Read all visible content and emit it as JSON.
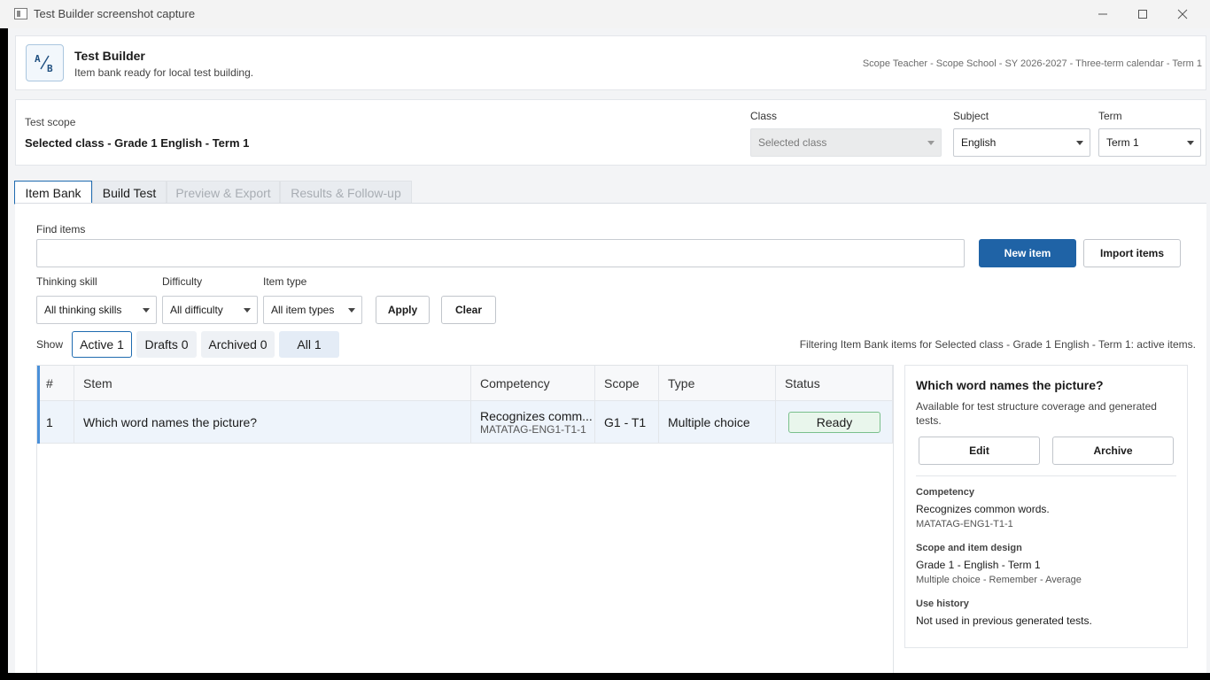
{
  "window": {
    "title": "Test Builder screenshot capture",
    "minimize_icon": "minimize-icon",
    "maximize_icon": "maximize-icon",
    "close_icon": "close-icon"
  },
  "header": {
    "logo_icon": "ab-logo-icon",
    "app_name": "Test Builder",
    "status": "Item bank ready for local test building.",
    "context": "Scope Teacher - Scope School - SY 2026-2027 - Three-term calendar - Term 1"
  },
  "scope": {
    "label": "Test scope",
    "value": "Selected class - Grade 1 English - Term 1",
    "class_label": "Class",
    "class_value": "Selected class",
    "subject_label": "Subject",
    "subject_value": "English",
    "term_label": "Term",
    "term_value": "Term 1"
  },
  "tabs": [
    {
      "label": "Item Bank",
      "state": "active"
    },
    {
      "label": "Build Test",
      "state": "normal"
    },
    {
      "label": "Preview & Export",
      "state": "disabled"
    },
    {
      "label": "Results & Follow-up",
      "state": "disabled"
    }
  ],
  "search": {
    "label": "Find items",
    "value": "",
    "placeholder": ""
  },
  "actions": {
    "new_item": "New item",
    "import_items": "Import items"
  },
  "filters": {
    "thinking_label": "Thinking skill",
    "thinking_value": "All thinking skills",
    "difficulty_label": "Difficulty",
    "difficulty_value": "All difficulty",
    "type_label": "Item type",
    "type_value": "All item types",
    "apply": "Apply",
    "clear": "Clear"
  },
  "show": {
    "label": "Show",
    "chips": [
      "Active 1",
      "Drafts 0",
      "Archived 0",
      "All 1"
    ],
    "note": "Filtering Item Bank items for Selected class - Grade 1 English - Term 1: active items."
  },
  "table": {
    "headers": [
      "#",
      "Stem",
      "Competency",
      "Scope",
      "Type",
      "Status"
    ],
    "rows": [
      {
        "num": "1",
        "stem": "Which word names the picture?",
        "competency": "Recognizes comm...",
        "competency_code": "MATATAG-ENG1-T1-1",
        "scope": "G1 - T1",
        "type": "Multiple choice",
        "status": "Ready"
      }
    ]
  },
  "detail": {
    "title": "Which word names the picture?",
    "description": "Available for test structure coverage and generated tests.",
    "edit": "Edit",
    "archive": "Archive",
    "competency_heading": "Competency",
    "competency_value": "Recognizes common words.",
    "competency_code": "MATATAG-ENG1-T1-1",
    "scope_heading": "Scope and item design",
    "scope_value": "Grade 1 - English - Term 1",
    "scope_detail": "Multiple choice - Remember - Average",
    "history_heading": "Use history",
    "history_value": "Not used in previous generated tests."
  }
}
